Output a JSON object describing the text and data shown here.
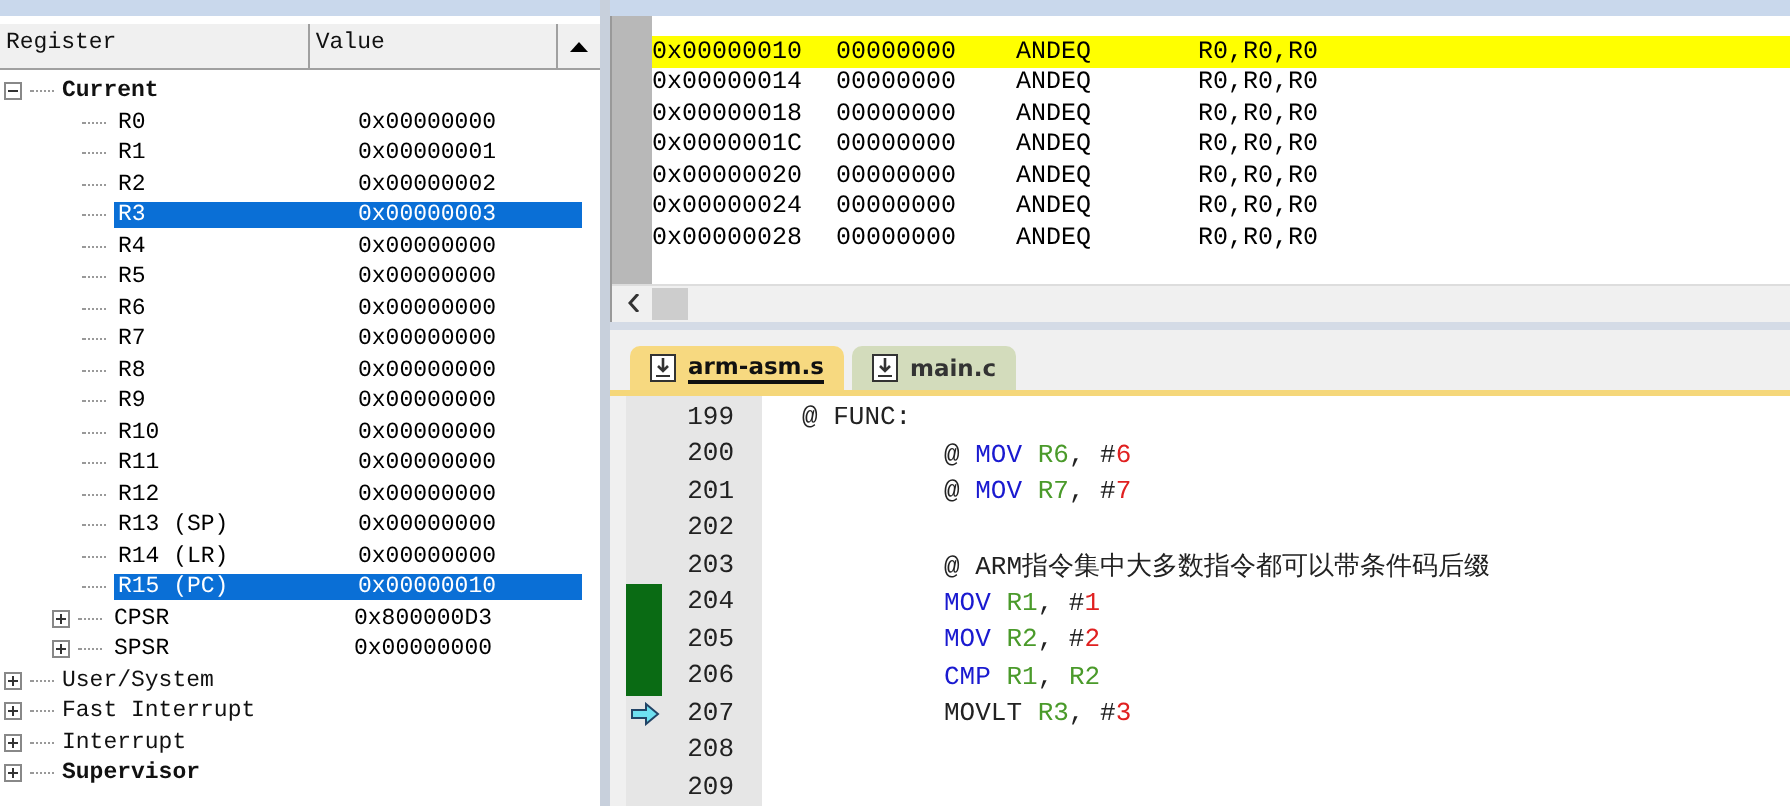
{
  "registers": {
    "columns": [
      "Register",
      "Value"
    ],
    "tree": [
      {
        "label": "Current",
        "bold": true,
        "expanded": true,
        "selected": false,
        "children": [
          {
            "label": "R0",
            "value": "0x00000000",
            "selected": false
          },
          {
            "label": "R1",
            "value": "0x00000001",
            "selected": false
          },
          {
            "label": "R2",
            "value": "0x00000002",
            "selected": false
          },
          {
            "label": "R3",
            "value": "0x00000003",
            "selected": true
          },
          {
            "label": "R4",
            "value": "0x00000000",
            "selected": false
          },
          {
            "label": "R5",
            "value": "0x00000000",
            "selected": false
          },
          {
            "label": "R6",
            "value": "0x00000000",
            "selected": false
          },
          {
            "label": "R7",
            "value": "0x00000000",
            "selected": false
          },
          {
            "label": "R8",
            "value": "0x00000000",
            "selected": false
          },
          {
            "label": "R9",
            "value": "0x00000000",
            "selected": false
          },
          {
            "label": "R10",
            "value": "0x00000000",
            "selected": false
          },
          {
            "label": "R11",
            "value": "0x00000000",
            "selected": false
          },
          {
            "label": "R12",
            "value": "0x00000000",
            "selected": false
          },
          {
            "label": "R13 (SP)",
            "value": "0x00000000",
            "selected": false
          },
          {
            "label": "R14 (LR)",
            "value": "0x00000000",
            "selected": false
          },
          {
            "label": "R15 (PC)",
            "value": "0x00000010",
            "selected": true
          },
          {
            "label": "CPSR",
            "value": "0x800000D3",
            "selected": false,
            "expanded": false
          },
          {
            "label": "SPSR",
            "value": "0x00000000",
            "selected": false,
            "expanded": false
          }
        ]
      },
      {
        "label": "User/System",
        "bold": false,
        "expanded": false,
        "selected": false
      },
      {
        "label": "Fast Interrupt",
        "bold": false,
        "expanded": false,
        "selected": false
      },
      {
        "label": "Interrupt",
        "bold": false,
        "expanded": false,
        "selected": false
      },
      {
        "label": "Supervisor",
        "bold": true,
        "expanded": false,
        "selected": false
      }
    ]
  },
  "disassembly": {
    "rows": [
      {
        "address": "0x00000010",
        "opcode": "00000000",
        "mnemonic": "ANDEQ",
        "operands": "R0,R0,R0",
        "current": true
      },
      {
        "address": "0x00000014",
        "opcode": "00000000",
        "mnemonic": "ANDEQ",
        "operands": "R0,R0,R0",
        "current": false
      },
      {
        "address": "0x00000018",
        "opcode": "00000000",
        "mnemonic": "ANDEQ",
        "operands": "R0,R0,R0",
        "current": false
      },
      {
        "address": "0x0000001C",
        "opcode": "00000000",
        "mnemonic": "ANDEQ",
        "operands": "R0,R0,R0",
        "current": false
      },
      {
        "address": "0x00000020",
        "opcode": "00000000",
        "mnemonic": "ANDEQ",
        "operands": "R0,R0,R0",
        "current": false
      },
      {
        "address": "0x00000024",
        "opcode": "00000000",
        "mnemonic": "ANDEQ",
        "operands": "R0,R0,R0",
        "current": false
      },
      {
        "address": "0x00000028",
        "opcode": "00000000",
        "mnemonic": "ANDEQ",
        "operands": "R0,R0,R0",
        "current": false
      }
    ]
  },
  "editor": {
    "tabs": [
      {
        "label": "arm-asm.s",
        "selected": true
      },
      {
        "label": "main.c",
        "selected": false
      }
    ],
    "lines": [
      {
        "number": "199",
        "covered": false,
        "current": false,
        "indent": false,
        "tokens": [
          {
            "kind": "plain",
            "text": "@ FUNC:"
          }
        ]
      },
      {
        "number": "200",
        "covered": false,
        "current": false,
        "indent": true,
        "tokens": [
          {
            "kind": "plain",
            "text": "@ "
          },
          {
            "kind": "keyword",
            "text": "MOV "
          },
          {
            "kind": "register",
            "text": "R6"
          },
          {
            "kind": "plain",
            "text": ", #"
          },
          {
            "kind": "number",
            "text": "6"
          }
        ]
      },
      {
        "number": "201",
        "covered": false,
        "current": false,
        "indent": true,
        "tokens": [
          {
            "kind": "plain",
            "text": "@ "
          },
          {
            "kind": "keyword",
            "text": "MOV "
          },
          {
            "kind": "register",
            "text": "R7"
          },
          {
            "kind": "plain",
            "text": ", #"
          },
          {
            "kind": "number",
            "text": "7"
          }
        ]
      },
      {
        "number": "202",
        "covered": false,
        "current": false
      },
      {
        "number": "203",
        "covered": false,
        "current": false,
        "indent": true,
        "tokens": [
          {
            "kind": "plain",
            "text": "@ ARM指令集中大多数指令都可以带条件码后缀"
          }
        ]
      },
      {
        "number": "204",
        "covered": true,
        "current": false,
        "indent": true,
        "tokens": [
          {
            "kind": "keyword",
            "text": "MOV "
          },
          {
            "kind": "register",
            "text": "R1"
          },
          {
            "kind": "plain",
            "text": ", #"
          },
          {
            "kind": "number",
            "text": "1"
          }
        ]
      },
      {
        "number": "205",
        "covered": true,
        "current": false,
        "indent": true,
        "tokens": [
          {
            "kind": "keyword",
            "text": "MOV "
          },
          {
            "kind": "register",
            "text": "R2"
          },
          {
            "kind": "plain",
            "text": ", #"
          },
          {
            "kind": "number",
            "text": "2"
          }
        ]
      },
      {
        "number": "206",
        "covered": true,
        "current": false,
        "indent": true,
        "tokens": [
          {
            "kind": "keyword",
            "text": "CMP "
          },
          {
            "kind": "register",
            "text": "R1"
          },
          {
            "kind": "plain",
            "text": ", "
          },
          {
            "kind": "register",
            "text": "R2"
          }
        ]
      },
      {
        "number": "207",
        "covered": false,
        "current": true,
        "indent": true,
        "tokens": [
          {
            "kind": "plain",
            "text": "MOVLT "
          },
          {
            "kind": "register",
            "text": "R3"
          },
          {
            "kind": "plain",
            "text": ", #"
          },
          {
            "kind": "number",
            "text": "3"
          }
        ]
      },
      {
        "number": "208",
        "covered": false,
        "current": false
      },
      {
        "number": "209",
        "covered": false,
        "current": false
      }
    ]
  }
}
